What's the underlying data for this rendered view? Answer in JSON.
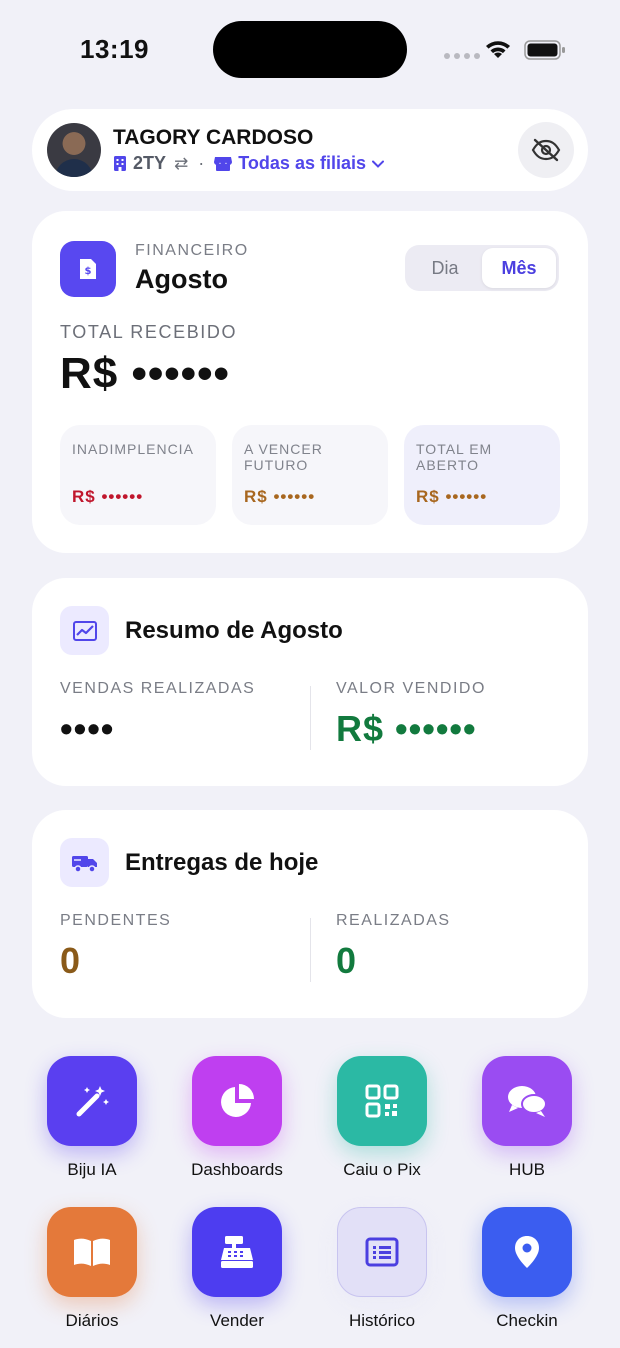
{
  "status_bar": {
    "time": "13:19"
  },
  "header": {
    "user_name": "TAGORY CARDOSO",
    "company_code": "2TY",
    "separator": "·",
    "branch_label": "Todas as filiais"
  },
  "financial": {
    "section_label": "FINANCEIRO",
    "month": "Agosto",
    "period_options": [
      "Dia",
      "Mês"
    ],
    "selected_period": "Mês",
    "total_label": "TOTAL RECEBIDO",
    "total_value": "R$ ••••••",
    "metrics": [
      {
        "label": "INADIMPLENCIA",
        "value": "R$ ••••••",
        "color": "#c0162c",
        "bg": "#f6f6fa"
      },
      {
        "label": "A VENCER FUTURO",
        "value": "R$ ••••••",
        "color": "#a8671f",
        "bg": "#f6f6fa"
      },
      {
        "label": "TOTAL EM ABERTO",
        "value": "R$ ••••••",
        "color": "#a8671f",
        "bg": "#efeffb"
      }
    ]
  },
  "summary": {
    "title": "Resumo de Agosto",
    "sales_label": "VENDAS REALIZADAS",
    "sales_value": "••••",
    "amount_label": "VALOR VENDIDO",
    "amount_value": "R$ ••••••",
    "amount_color": "#127a3e"
  },
  "deliveries": {
    "title": "Entregas de hoje",
    "pending_label": "PENDENTES",
    "pending_value": "0",
    "pending_color": "#8a5a19",
    "done_label": "REALIZADAS",
    "done_value": "0",
    "done_color": "#127a3e"
  },
  "shortcuts": [
    {
      "label": "Biju IA",
      "icon": "magic-wand-icon",
      "color": "#5a3ff0"
    },
    {
      "label": "Dashboards",
      "icon": "pie-chart-icon",
      "color": "#bf3ff0"
    },
    {
      "label": "Caiu o Pix",
      "icon": "qr-code-icon",
      "color": "#2bb9a4"
    },
    {
      "label": "HUB",
      "icon": "chat-bubbles-icon",
      "color": "#9a4cf2"
    },
    {
      "label": "Diários",
      "icon": "book-icon",
      "color": "#e4793a"
    },
    {
      "label": "Vender",
      "icon": "cash-register-icon",
      "color": "#4d3df0"
    },
    {
      "label": "Histórico",
      "icon": "list-icon",
      "color": "#e2e0f7"
    },
    {
      "label": "Checkin",
      "icon": "map-pin-icon",
      "color": "#3b5df0"
    }
  ]
}
